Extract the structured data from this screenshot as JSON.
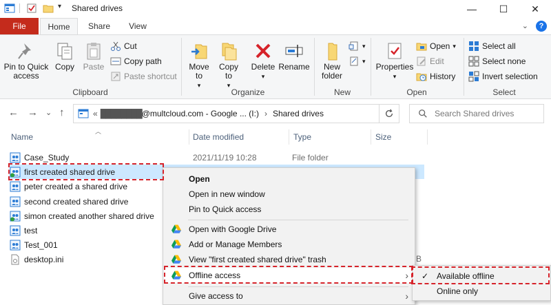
{
  "window": {
    "title": "Shared drives",
    "minimize": "—",
    "maximize": "☐",
    "close": "✕"
  },
  "tabs": {
    "file": "File",
    "home": "Home",
    "share": "Share",
    "view": "View",
    "collapse": "⌄",
    "help": "?"
  },
  "ribbon": {
    "clipboard": {
      "label": "Clipboard",
      "pin": "Pin to Quick access",
      "copy": "Copy",
      "paste": "Paste",
      "cut": "Cut",
      "copy_path": "Copy path",
      "paste_shortcut": "Paste shortcut"
    },
    "organize": {
      "label": "Organize",
      "move_to": "Move to",
      "copy_to": "Copy to",
      "delete": "Delete",
      "rename": "Rename"
    },
    "new": {
      "label": "New",
      "new_folder": "New folder"
    },
    "open": {
      "label": "Open",
      "properties": "Properties",
      "open": "Open",
      "edit": "Edit",
      "history": "History"
    },
    "select": {
      "label": "Select",
      "select_all": "Select all",
      "select_none": "Select none",
      "invert": "Invert selection"
    }
  },
  "nav": {
    "back": "←",
    "forward": "→",
    "recent": "⌄",
    "up": "↑",
    "path_prefix": "«",
    "path_masked": "████████",
    "path_account": "@multcloud.com - Google ... (I:)",
    "path_sep": "›",
    "path_current": "Shared drives",
    "search_placeholder": "Search Shared drives"
  },
  "columns": {
    "name": "Name",
    "date": "Date modified",
    "type": "Type",
    "size": "Size"
  },
  "files": [
    {
      "name": "Case_Study",
      "date": "2021/11/19 10:28",
      "type": "File folder"
    },
    {
      "name": "first created shared drive",
      "date": "",
      "type": ""
    },
    {
      "name": "peter created a shared drive",
      "date": "",
      "type": ""
    },
    {
      "name": "second created shared drive",
      "date": "",
      "type": ""
    },
    {
      "name": "simon created another shared drive",
      "date": "",
      "type": ""
    },
    {
      "name": "test",
      "date": "",
      "type": ""
    },
    {
      "name": "Test_001",
      "date": "",
      "type": ""
    },
    {
      "name": "desktop.ini",
      "date": "",
      "type": ""
    }
  ],
  "partial_size": "B",
  "context_menu": {
    "open": "Open",
    "open_new_window": "Open in new window",
    "pin_quick": "Pin to Quick access",
    "open_google": "Open with Google Drive",
    "manage_members": "Add or Manage Members",
    "view_trash": "View \"first created shared drive\" trash",
    "offline_access": "Offline access",
    "give_access": "Give access to",
    "arrow": "›"
  },
  "submenu": {
    "available_offline": "Available offline",
    "online_only": "Online only",
    "check": "✓"
  },
  "colors": {
    "file_tab": "#c42b1c",
    "selection": "#cce8ff",
    "highlight_box": "#d6232a"
  }
}
